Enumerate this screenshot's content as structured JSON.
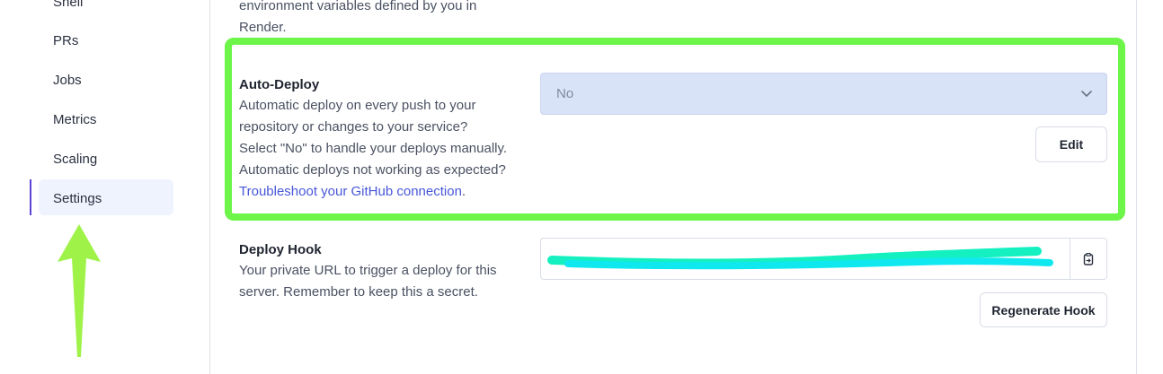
{
  "sidebar": {
    "items": [
      {
        "label": "Shell"
      },
      {
        "label": "PRs"
      },
      {
        "label": "Jobs"
      },
      {
        "label": "Metrics"
      },
      {
        "label": "Scaling"
      },
      {
        "label": "Settings",
        "active": true
      }
    ]
  },
  "env_section": {
    "desc_line1": "environment variables defined by you in",
    "desc_line2": "Render."
  },
  "auto_deploy": {
    "title": "Auto-Deploy",
    "desc_line1": "Automatic deploy on every push to your",
    "desc_line2": "repository or changes to your service?",
    "desc_line3": "Select \"No\" to handle your deploys manually.",
    "desc_line4": "Automatic deploys not working as expected?",
    "link_text": "Troubleshoot your GitHub connection",
    "link_suffix": ".",
    "select_value": "No",
    "edit_label": "Edit"
  },
  "deploy_hook": {
    "title": "Deploy Hook",
    "desc_line1": "Your private URL to trigger a deploy for this",
    "desc_line2": "server. Remember to keep this a secret.",
    "regenerate_label": "Regenerate Hook"
  },
  "colors": {
    "highlight": "#6df54a",
    "accent": "#5b45d6",
    "link": "#4757d8",
    "redaction": "#14f0d0"
  },
  "icons": {
    "select_chevron": "chevron-down-icon",
    "copy": "clipboard-icon",
    "annotation": "arrow-up-icon"
  }
}
